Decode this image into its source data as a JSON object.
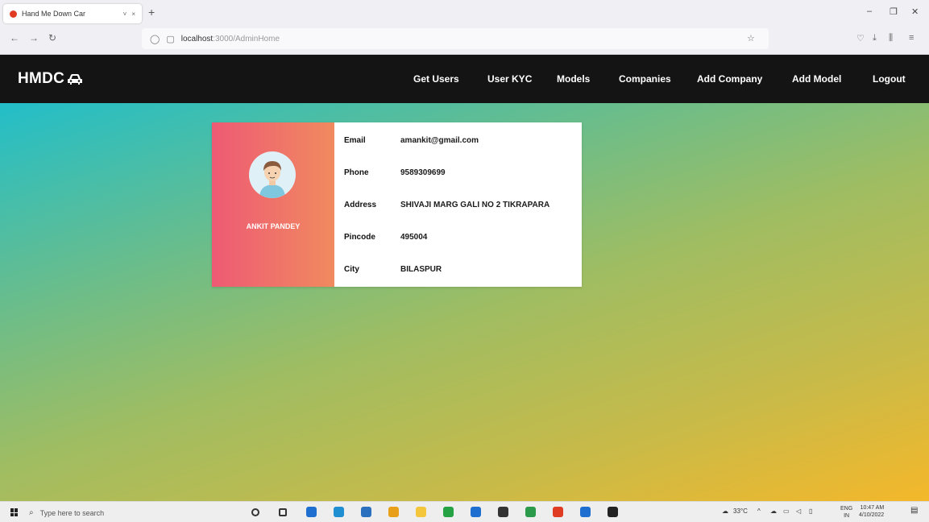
{
  "browser": {
    "tab_title": "Hand Me Down Car",
    "tab_chevron": "˅",
    "tab_close": "×",
    "new_tab": "+",
    "url_host": "localhost",
    "url_path": ":3000/AdminHome",
    "window_min": "–",
    "window_restore": "❐",
    "window_close": "✕"
  },
  "site": {
    "brand": "HMDC",
    "nav": [
      "Get Users",
      "User KYC",
      "Models",
      "Companies",
      "Add Company",
      "Add Model",
      "Logout"
    ]
  },
  "profile": {
    "name": "ANKIT PANDEY",
    "fields": [
      {
        "label": "Email",
        "value": "amankit@gmail.com"
      },
      {
        "label": "Phone",
        "value": "9589309699"
      },
      {
        "label": "Address",
        "value": "SHIVAJI MARG GALI NO 2 TIKRAPARA"
      },
      {
        "label": "Pincode",
        "value": "495004"
      },
      {
        "label": "City",
        "value": "BILASPUR"
      }
    ]
  },
  "taskbar": {
    "search_placeholder": "Type here to search",
    "weather": "33°C",
    "lang": "ENG",
    "lang2": "IN",
    "time": "10:47 AM",
    "date": "4/10/2022",
    "icon_colors": [
      "#333333",
      "#333333",
      "#1f6fd1",
      "#1f8fd1",
      "#2b6fbf",
      "#e8a01a",
      "#f3c63c",
      "#25a244",
      "#1f6fd1",
      "#333333",
      "#2b9a4a",
      "#e03c24",
      "#1f6fd1",
      "#222222"
    ]
  }
}
